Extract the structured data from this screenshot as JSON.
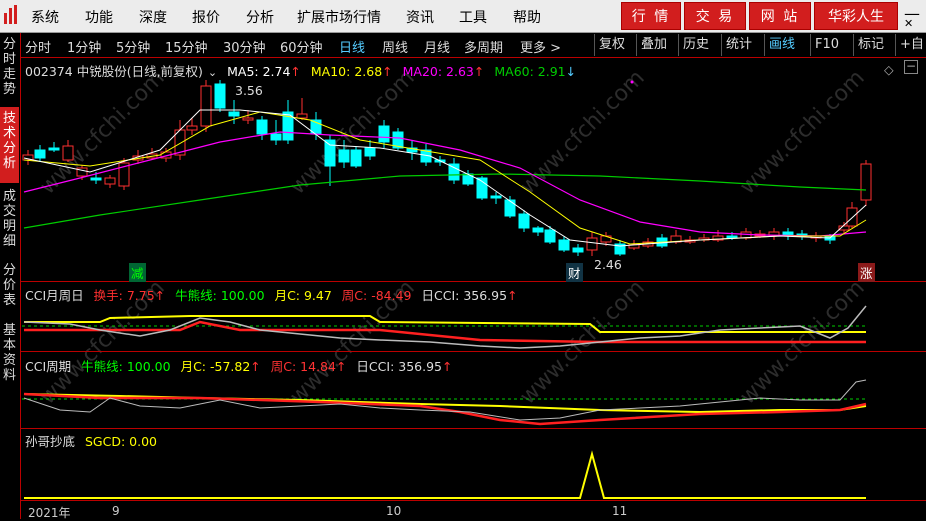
{
  "menubar": {
    "items": [
      "系统",
      "功能",
      "深度",
      "报价",
      "分析",
      "扩展市场行情",
      "资讯",
      "工具",
      "帮助"
    ],
    "buttons": [
      "行 情",
      "交 易",
      "网 站",
      "华彩人生"
    ],
    "win_min": "—",
    "win_close": "✕"
  },
  "sidebar": {
    "tabs": [
      "分时走势",
      "技术分析",
      "成交明细",
      "分价表",
      "基本资料"
    ],
    "active": 1
  },
  "periods": {
    "items": [
      "分时",
      "1分钟",
      "5分钟",
      "15分钟",
      "30分钟",
      "60分钟",
      "日线",
      "周线",
      "月线",
      "多周期",
      "更多 >"
    ],
    "active": "日线",
    "tools": [
      "复权",
      "叠加",
      "历史",
      "统计",
      "画线",
      "F10",
      "标记",
      "+自"
    ],
    "active_tool": "画线"
  },
  "main_chart": {
    "stock": "002374 中锐股份(日线,前复权)",
    "ma5": "MA5: 2.74",
    "ma10": "MA10: 2.68",
    "ma20": "MA20: 2.63",
    "ma60": "MA60: 2.91",
    "ma5_arrow": "↑",
    "ma10_arrow": "↑",
    "ma20_arrow": "↑",
    "ma60_arrow": "↓",
    "high_label": "3.56",
    "low_label": "2.46",
    "marker_jian": "减",
    "marker_cai": "财",
    "marker_zhang": "涨",
    "colors": {
      "ma5": "#ffffff",
      "ma10": "#ffff00",
      "ma20": "#ff00ff",
      "ma60": "#00cc00",
      "up": "#ff3030",
      "down": "#00ffff"
    }
  },
  "indicator1": {
    "name": "CCI月周日",
    "huanshou": "换手: 7.75",
    "niuneng": "牛熊线: 100.00",
    "yuec": "月C: 9.47",
    "zhouc": "周C: -84.49",
    "ricci": "日CCI: 356.95",
    "arrow": "↑"
  },
  "indicator2": {
    "name": "CCI周期",
    "niuneng": "牛熊线: 100.00",
    "yuec": "月C: -57.82",
    "zhouc": "周C: 14.84",
    "ricci": "日CCI: 356.95",
    "arrow": "↑"
  },
  "indicator3": {
    "name": "孙哥抄底",
    "sgcd": "SGCD: 0.00"
  },
  "dates": [
    "2021年",
    "9",
    "10",
    "11"
  ],
  "watermark": "www.cfchi.com"
}
